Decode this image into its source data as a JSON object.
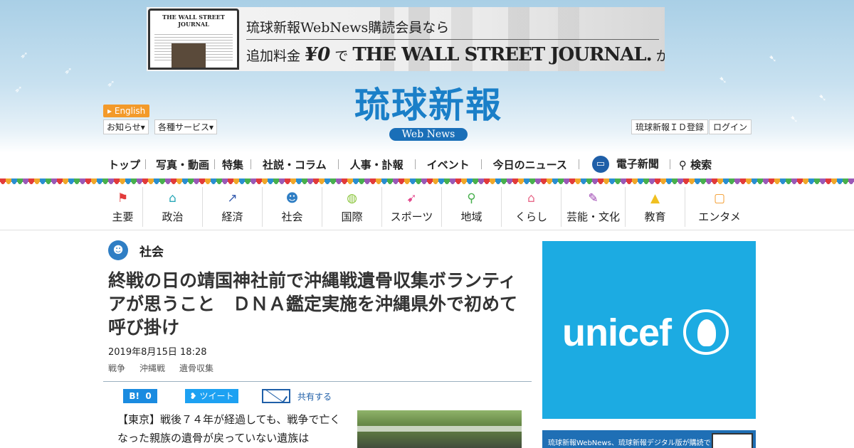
{
  "ad": {
    "line1": "琉球新報WebNews購読会員なら",
    "line2_prefix": "追加料金",
    "line2_price": "¥0",
    "line2_de": "で",
    "line2_brand": "THE WALL STREET JOURNAL.",
    "line2_suffix": "が読める",
    "mini_masthead": "THE WALL STREET JOURNAL"
  },
  "header": {
    "english": "English",
    "notice": "お知らせ",
    "services": "各種サービス",
    "register": "琉球新報ＩＤ登録",
    "login": "ログイン",
    "logo_main": "琉球新報",
    "logo_sub": "Web News"
  },
  "mainnav": {
    "top": "トップ",
    "photo": "写真・動画",
    "feature": "特集",
    "editorial": "社説・コラム",
    "personnel": "人事・訃報",
    "event": "イベント",
    "today": "今日のニュース",
    "epaper": "電子新聞",
    "search": "検索"
  },
  "catnav": [
    {
      "label": "主要",
      "icon": "flag-icon",
      "color": "#e23b3b"
    },
    {
      "label": "政治",
      "icon": "building-icon",
      "color": "#2aa8b8"
    },
    {
      "label": "経済",
      "icon": "chart-icon",
      "color": "#3a5fb0"
    },
    {
      "label": "社会",
      "icon": "people-icon",
      "color": "#2f7ec4"
    },
    {
      "label": "国際",
      "icon": "globe-icon",
      "color": "#8cc63f"
    },
    {
      "label": "スポーツ",
      "icon": "runner-icon",
      "color": "#e2458a"
    },
    {
      "label": "地域",
      "icon": "pin-icon",
      "color": "#48b04e"
    },
    {
      "label": "くらし",
      "icon": "house-icon",
      "color": "#e86a8a"
    },
    {
      "label": "芸能・文化",
      "icon": "brush-icon",
      "color": "#9b3fb0"
    },
    {
      "label": "教育",
      "icon": "cap-icon",
      "color": "#f0c020"
    },
    {
      "label": "エンタメ",
      "icon": "tv-icon",
      "color": "#f39a2a"
    }
  ],
  "article": {
    "section": "社会",
    "headline": "終戦の日の靖国神社前で沖縄戦遺骨収集ボランティアが思うこと　ＤＮＡ鑑定実施を沖縄県外で初めて呼び掛け",
    "date": "2019年8月15日 18:28",
    "tags": [
      "戦争",
      "沖縄戦",
      "遺骨収集"
    ],
    "hatena_count": "0",
    "tweet": "ツイート",
    "share": "共有する",
    "body": "【東京】戦後７４年が経過しても、戦争で亡くなった親族の遺骨が戻っていない遺族は"
  },
  "sidebar": {
    "unicef": "unicef",
    "ad2": "琉球新報WebNews、琉球新報デジタル版が購読できる"
  }
}
